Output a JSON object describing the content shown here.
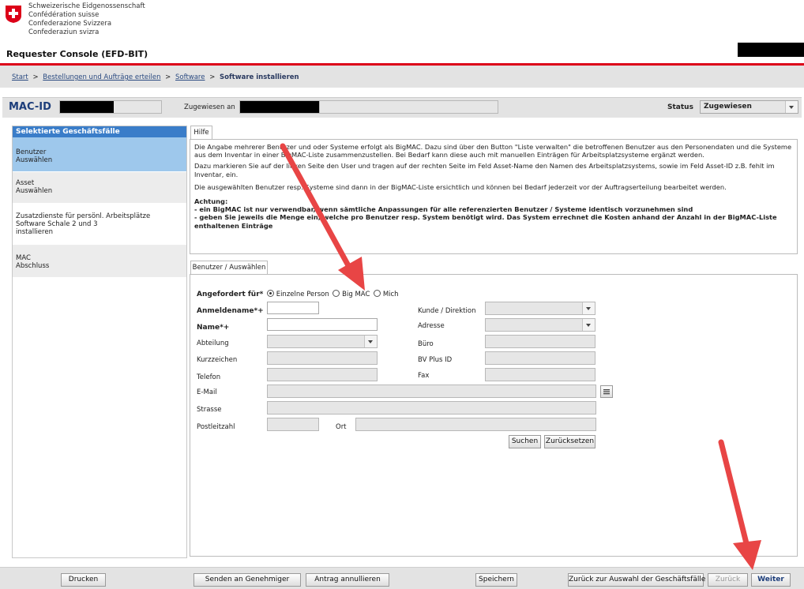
{
  "brand": {
    "lines": [
      "Schweizerische Eidgenossenschaft",
      "Confédération suisse",
      "Confederazione Svizzera",
      "Confederaziun svizra"
    ],
    "app_title": "Requester Console (EFD-BIT)"
  },
  "breadcrumb": {
    "items": [
      "Start",
      "Bestellungen und Aufträge erteilen",
      "Software"
    ],
    "separator": ">",
    "current": "Software installieren"
  },
  "header": {
    "mac_label": "MAC-ID",
    "assigned_label": "Zugewiesen an",
    "status_label": "Status",
    "status_value": "Zugewiesen"
  },
  "sidebar": {
    "title": "Selektierte Geschäftsfälle",
    "items": [
      {
        "lines": [
          "Benutzer",
          "Auswählen"
        ],
        "active": true
      },
      {
        "lines": [
          "Asset",
          "Auswählen"
        ],
        "active": false
      },
      {
        "lines": [
          "Zusatzdienste für persönl. Arbeitsplätze",
          "Software Schale 2 und 3",
          "installieren"
        ],
        "active": false
      },
      {
        "lines": [
          "MAC",
          "Abschluss"
        ],
        "active": false
      }
    ]
  },
  "help": {
    "tab": "Hilfe",
    "p1": "Die Angabe mehrerer Benutzer und oder Systeme erfolgt als BigMAC. Dazu sind über den Button \"Liste verwalten\" die betroffenen Benutzer aus den Personendaten und die Systeme aus dem Inventar in einer BigMAC-Liste zusammenzustellen. Bei Bedarf kann diese auch mit manuellen Einträgen für Arbeitsplatzsysteme ergänzt werden.",
    "p2": "Dazu markieren Sie auf der linken Seite den User und tragen auf der rechten Seite im Feld Asset-Name den Namen des Arbeitsplatzsystems, sowie im Feld Asset-ID z.B. fehlt im Inventar, ein.",
    "p3": "Die ausgewählten Benutzer resp. Systeme sind dann in der BigMAC-Liste ersichtlich und können bei Bedarf jederzeit vor der Auftragserteilung bearbeitet werden.",
    "warn_title": "Achtung:",
    "warn1": "- ein BigMAC ist nur verwendbar, wenn sämtliche Anpassungen für alle referenzierten Benutzer / Systeme identisch vorzunehmen sind",
    "warn2": "- geben Sie jeweils die Menge ein, welche pro Benutzer resp. System benötigt wird. Das System errechnet die Kosten anhand der Anzahl in der BigMAC-Liste enthaltenen Einträge"
  },
  "form": {
    "tab": "Benutzer / Auswählen",
    "requested_for_label": "Angefordert für*",
    "radios": [
      {
        "label": "Einzelne Person",
        "checked": true
      },
      {
        "label": "Big MAC",
        "checked": false
      },
      {
        "label": "Mich",
        "checked": false
      }
    ],
    "login_label": "Anmeldename*+",
    "name_label": "Name*+",
    "department_label": "Abteilung",
    "short_label": "Kurzzeichen",
    "phone_label": "Telefon",
    "email_label": "E-Mail",
    "street_label": "Strasse",
    "zip_label": "Postleitzahl",
    "city_label": "Ort",
    "customer_label": "Kunde / Direktion",
    "address_label": "Adresse",
    "office_label": "Büro",
    "bvplus_label": "BV Plus ID",
    "fax_label": "Fax",
    "search_button": "Suchen",
    "reset_button": "Zurücksetzen"
  },
  "footer": {
    "print": "Drucken",
    "send": "Senden an Genehmiger",
    "cancel": "Antrag annullieren",
    "save": "Speichern",
    "back_to_selection": "Zurück zur Auswahl der Geschäftsfälle",
    "back": "Zurück",
    "next": "Weiter"
  },
  "colors": {
    "accent_red": "#dc0018",
    "sidebar_active": "#9ec8ec",
    "sidebar_header": "#3a7dc9",
    "annotation_arrow": "#e84545"
  }
}
